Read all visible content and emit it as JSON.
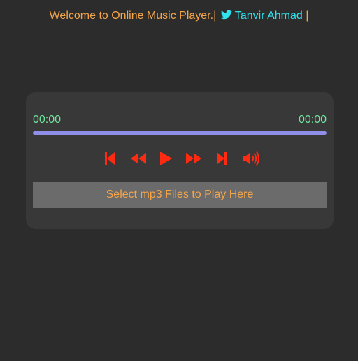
{
  "header": {
    "welcome_text": "Welcome to Online Music Player.|",
    "author_link": "Tanvir Ahmad",
    "trailing_separator": "|",
    "twitter_icon": "twitter-icon"
  },
  "player": {
    "current_time": "00:00",
    "total_time": "00:00",
    "progress": 0,
    "controls": [
      {
        "name": "skip-start-icon",
        "label": "previous track"
      },
      {
        "name": "rewind-icon",
        "label": "rewind"
      },
      {
        "name": "play-icon",
        "label": "play"
      },
      {
        "name": "fast-forward-icon",
        "label": "fast forward"
      },
      {
        "name": "skip-end-icon",
        "label": "next track"
      },
      {
        "name": "volume-icon",
        "label": "volume"
      }
    ],
    "select_label": "Select mp3 Files to Play Here"
  },
  "colors": {
    "background": "#2c2c2c",
    "panel": "#383838",
    "header_text": "#f5a54a",
    "link": "#2fe4ee",
    "time_text": "#6fe39a",
    "progress_track": "#8f8fea",
    "controls": "#ff2a12",
    "select_button_bg": "#6b6b6b"
  }
}
